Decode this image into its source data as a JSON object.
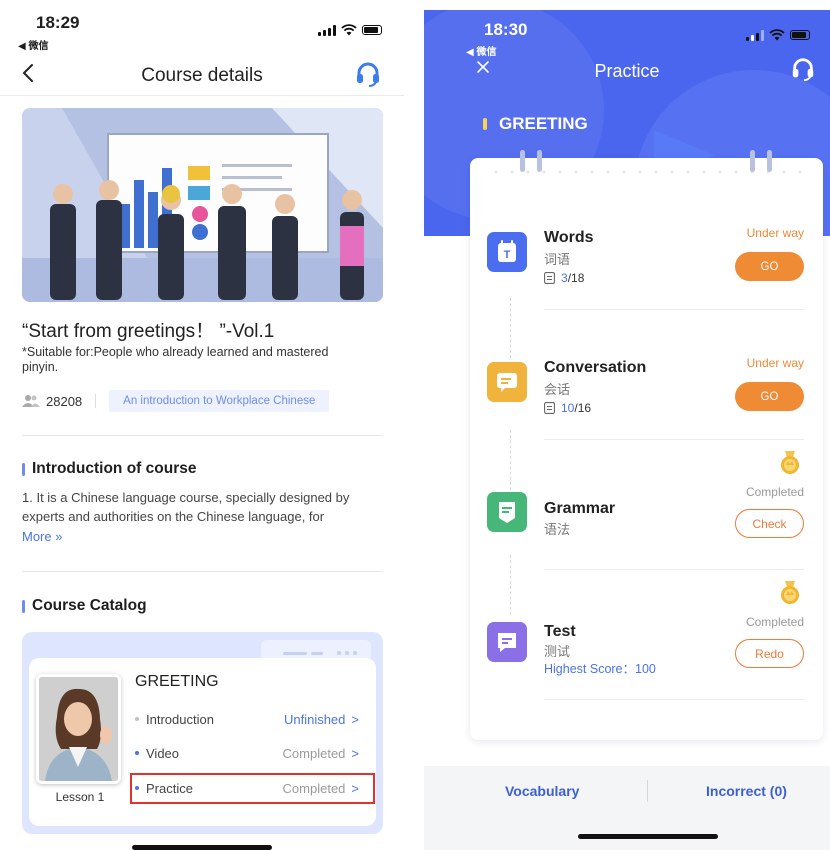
{
  "left": {
    "status": {
      "time": "18:29",
      "back": "◀ 微信"
    },
    "nav": {
      "title": "Course details"
    },
    "course": {
      "title": "“Start from greetings！ ”-Vol.1",
      "suitable": "*Suitable for:People who already learned and mastered pinyin.",
      "learners": "28208",
      "tag": "An introduction to Workplace Chinese"
    },
    "intro": {
      "heading": "Introduction of course",
      "text": "1. It is a Chinese language course, specially designed by experts and authorities on the Chinese language, for",
      "more": "More »"
    },
    "catalog": {
      "heading": "Course Catalog",
      "lesson_title": "GREETING",
      "lesson_label": "Lesson 1",
      "rows": [
        {
          "label": "Introduction",
          "status": "Unfinished"
        },
        {
          "label": "Video",
          "status": "Completed"
        },
        {
          "label": "Practice",
          "status": "Completed"
        }
      ]
    }
  },
  "right": {
    "status": {
      "time": "18:30",
      "back": "◀ 微信"
    },
    "nav": {
      "title": "Practice"
    },
    "section": "GREETING",
    "tasks": [
      {
        "name": "Words",
        "cn": "词语",
        "current": "3",
        "total": "/18",
        "status": "Under way",
        "action": "GO"
      },
      {
        "name": "Conversation",
        "cn": "会话",
        "current": "10",
        "total": "/16",
        "status": "Under way",
        "action": "GO"
      },
      {
        "name": "Grammar",
        "cn": "语法",
        "status": "Completed",
        "action": "Check"
      },
      {
        "name": "Test",
        "cn": "测试",
        "score": "Highest Score：100",
        "status": "Completed",
        "action": "Redo"
      }
    ],
    "bottom": {
      "vocabulary": "Vocabulary",
      "incorrect": "Incorrect (0)"
    }
  },
  "colors": {
    "accent": "#4b66ee",
    "link": "#4a74e6",
    "orange": "#ef8a35",
    "highlight": "#e0332b"
  }
}
